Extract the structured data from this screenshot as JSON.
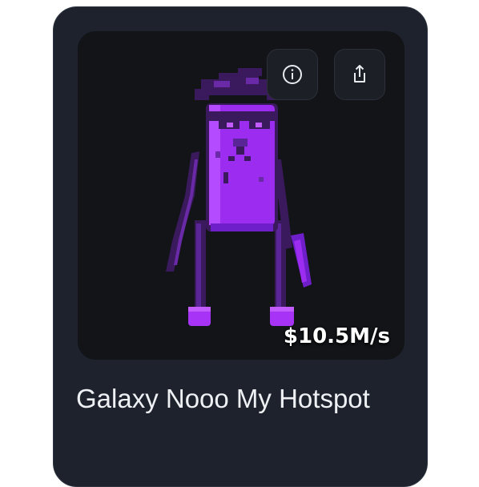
{
  "item": {
    "title": "Galaxy Nooo My Hotspot",
    "price": "$10.5M/s",
    "image_subject": "purple pixelated character figure"
  },
  "actions": {
    "info_icon": "info-icon",
    "share_icon": "share-icon"
  },
  "colors": {
    "card_background": "#1d222c",
    "thumbnail_background": "#121418",
    "character_primary": "#9b2cf0",
    "character_dark": "#3a1a5c",
    "text": "#eef0f4"
  }
}
